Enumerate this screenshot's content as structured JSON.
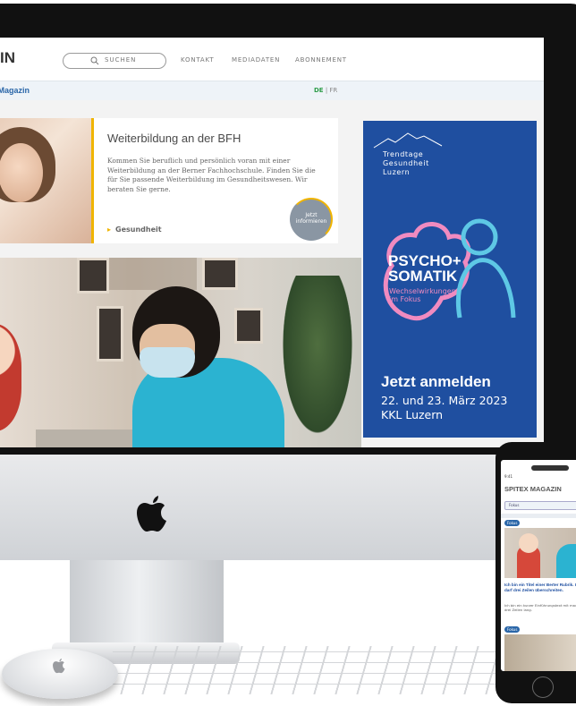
{
  "site": {
    "logo_fragment": "IN",
    "search_label": "SUCHEN",
    "nav": [
      "KONTAKT",
      "MEDIADATEN",
      "ABONNEMENT"
    ],
    "brand_sub": "x Magazin",
    "lang_de": "DE",
    "lang_sep": " | ",
    "lang_fr": "FR"
  },
  "teaser": {
    "title": "Weiterbildung an der BFH",
    "text": "Kommen Sie beruflich und persönlich voran mit einer Weiterbildung an der Berner Fachhochschule. Finden Sie die für Sie passende Weiterbildung im Gesundheitswesen. Wir beraten Sie gerne.",
    "tag": "Gesundheit",
    "cta_line1": "Jetzt",
    "cta_line2": "informieren"
  },
  "ad": {
    "trend_line1": "Trendtage",
    "trend_line2": "Gesundheit",
    "trend_line3": "Luzern",
    "headline1": "PSYCHO+",
    "headline2": "SOMATIK",
    "sub_line1": "Wechselwirkungen",
    "sub_line2": "im Fokus",
    "cta": "Jetzt anmelden",
    "date_line1": "22. und 23. März 2023",
    "date_line2": "KKL Luzern"
  },
  "phone": {
    "time": "9:41",
    "brand": "SPITEX MAGAZIN",
    "search_text": "Fokus",
    "badge1": "Fokus",
    "badge2": "Fokus",
    "title": "Ich bin ein Titel einer Berter Rubrik. Und darf drei Zeilen überschreiten.",
    "body": "Ich bin ein kurzer Einführungstext mit maximal drei Zeilen lang."
  },
  "colors": {
    "accent_yellow": "#f0b400",
    "brand_blue": "#2a66a8",
    "ad_blue": "#1f4fa0",
    "ad_pink": "#f08bc0",
    "ad_cyan": "#5ec8e5"
  }
}
